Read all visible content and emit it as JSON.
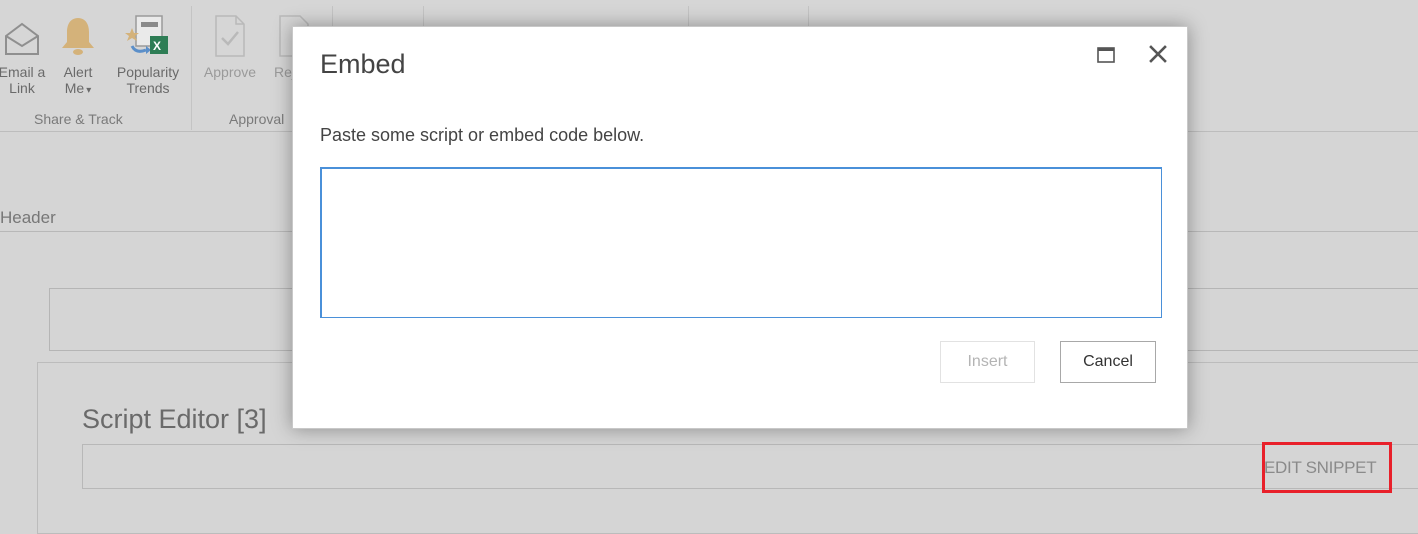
{
  "ribbon": {
    "groups": [
      {
        "label": "Share & Track",
        "buttons": [
          {
            "label_line1": "Email a",
            "label_line2": "Link",
            "icon": "envelope-icon"
          },
          {
            "label_line1": "Alert",
            "label_line2": "Me",
            "icon": "bell-icon",
            "has_dropdown": true
          },
          {
            "label_line1": "Popularity",
            "label_line2": "Trends",
            "icon": "popularity-trends-excel-icon"
          }
        ]
      },
      {
        "label": "Approval",
        "buttons": [
          {
            "label_line1": "Approve",
            "label_line2": "",
            "icon": "approve-document-icon",
            "disabled": true
          },
          {
            "label_line1": "Reject",
            "label_line2": "",
            "icon": "reject-document-icon",
            "disabled": true
          }
        ]
      }
    ],
    "dropdown_glyph": "▾"
  },
  "page": {
    "header_label": "Header",
    "script_editor_title": "Script Editor [3]",
    "edit_snippet_label": "EDIT SNIPPET",
    "highlight_color": "#e8202a"
  },
  "dialog": {
    "title": "Embed",
    "maximize_icon": "maximize-icon",
    "close_glyph": "✕",
    "description": "Paste some script or embed code below.",
    "textarea_value": "",
    "insert_label": "Insert",
    "insert_disabled": true,
    "cancel_label": "Cancel",
    "accent_color": "#4a90d9"
  }
}
